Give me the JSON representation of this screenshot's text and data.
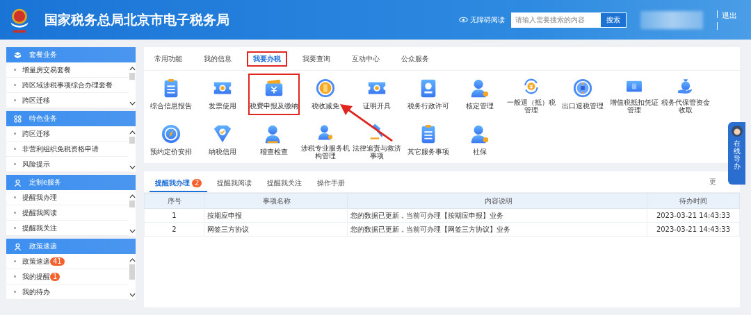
{
  "header": {
    "title": "国家税务总局北京市电子税务局",
    "accessibility": "无障碍阅读",
    "search": {
      "placeholder": "请输入需要搜索的内容",
      "button": "搜索"
    },
    "logout": "退出"
  },
  "sidebar": [
    {
      "title": "套餐业务",
      "items": [
        {
          "label": "增量房交易套餐"
        },
        {
          "label": "跨区域涉税事项综合办理套餐"
        },
        {
          "label": "跨区迁移"
        }
      ]
    },
    {
      "title": "特色业务",
      "items": [
        {
          "label": "跨区迁移"
        },
        {
          "label": "非营利组织免税资格申请"
        },
        {
          "label": "风险提示"
        }
      ]
    },
    {
      "title": "定制e服务",
      "items": [
        {
          "label": "提醒我办理"
        },
        {
          "label": "提醒我阅读"
        },
        {
          "label": "提醒我关注"
        }
      ]
    },
    {
      "title": "政策速递",
      "items": [
        {
          "label": "政策速递",
          "badge": "41"
        },
        {
          "label": "我的提醒",
          "badge": "1"
        },
        {
          "label": "我的待办"
        }
      ]
    }
  ],
  "service_tabs": [
    {
      "label": "常用功能",
      "selected": false
    },
    {
      "label": "我的信息",
      "selected": false
    },
    {
      "label": "我要办税",
      "selected": true
    },
    {
      "label": "我要查询",
      "selected": false
    },
    {
      "label": "互动中心",
      "selected": false
    },
    {
      "label": "公众服务",
      "selected": false
    }
  ],
  "services": [
    {
      "label": "综合信息报告",
      "highlighted": false
    },
    {
      "label": "发票使用",
      "highlighted": false
    },
    {
      "label": "税费申报及缴纳",
      "highlighted": true
    },
    {
      "label": "税收减免",
      "highlighted": false
    },
    {
      "label": "证明开具",
      "highlighted": false
    },
    {
      "label": "税务行政许可",
      "highlighted": false
    },
    {
      "label": "核定管理",
      "highlighted": false
    },
    {
      "label": "一般退（抵）税管理",
      "highlighted": false
    },
    {
      "label": "出口退税管理",
      "highlighted": false
    },
    {
      "label": "增值税抵扣凭证管理",
      "highlighted": false
    },
    {
      "label": "税务代保管资金收取",
      "highlighted": false
    },
    {
      "label": "预约定价安排",
      "highlighted": false
    },
    {
      "label": "纳税信用",
      "highlighted": false
    },
    {
      "label": "稽查检查",
      "highlighted": false
    },
    {
      "label": "涉税专业服务机构管理",
      "highlighted": false
    },
    {
      "label": "法律追责与救济事项",
      "highlighted": false
    },
    {
      "label": "其它服务事项",
      "highlighted": false
    },
    {
      "label": "社保",
      "highlighted": false
    }
  ],
  "reminder_tabs": [
    {
      "label": "提醒我办理",
      "badge": "2",
      "selected": true
    },
    {
      "label": "提醒我阅读",
      "selected": false
    },
    {
      "label": "提醒我关注",
      "selected": false
    },
    {
      "label": "操作手册",
      "selected": false
    }
  ],
  "more_link": "更",
  "table": {
    "columns": [
      "序号",
      "事项名称",
      "内容说明",
      "待办时间"
    ],
    "rows": [
      [
        "1",
        "按期应申报",
        "您的数据已更新，当前可办理【按期应申报】业务",
        "2023-03-21 14:43:33"
      ],
      [
        "2",
        "网签三方协议",
        "您的数据已更新，当前可办理【网签三方协议】业务",
        "2023-03-21 14:43:33"
      ]
    ]
  },
  "online_guide": "在线导办"
}
